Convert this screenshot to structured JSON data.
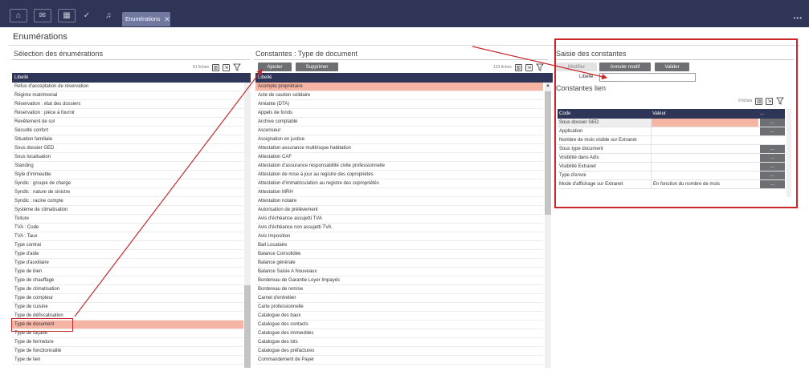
{
  "topbar": {
    "active_tab": "Enumérations",
    "close_glyph": "✕",
    "more_glyph": "•••",
    "icons": [
      "home-icon",
      "mail-icon",
      "calendar-icon",
      "check-icon",
      "bell-icon"
    ]
  },
  "page_title": "Enumérations",
  "left": {
    "title": "Sélection des énumérations",
    "count": "81 fiches",
    "column": "Libellé",
    "items": [
      "Refus d'acceptation de réservation",
      "Régime matrimonial",
      "Réservation : état des dossiers",
      "Réservation : pièce à fournir",
      "Revêtement de sol",
      "Sécurité confort",
      "Situation familiale",
      "Sous dossier GED",
      "Sous localisation",
      "Standing",
      "Style d'immeuble",
      "Syndic : groupe de charge",
      "Syndic : nature de sinistre",
      "Syndic : racine compte",
      "Système de climatisation",
      "Toiture",
      "TVA : Code",
      "TVA : Taux",
      "Type contrat",
      "Type d'aide",
      "Type d'auxiliaire",
      "Type de bien",
      "Type de chauffage",
      "Type de climatisation",
      "Type de compteur",
      "Type de cuisine",
      "Type de défiscalisation",
      "Type de document",
      "Type de façade",
      "Type de fermeture",
      "Type de fonctionnalité",
      "Type de lien"
    ],
    "selected_index": 27
  },
  "middle": {
    "title": "Constantes : Type de document",
    "add_label": "Ajouter",
    "delete_label": "Supprimer",
    "count": "133 fiches",
    "column": "Libellé",
    "items": [
      "Acompte propriétaire",
      "Acte de caution solidaire",
      "Amiante (DTA)",
      "Appels de fonds",
      "Archive comptable",
      "Ascenseur",
      "Assignation en justice",
      "Attestation assurance multirisque habitation",
      "Attestation CAF",
      "Attestation d'assurance responsabilité civile professionnelle",
      "Attestation de mise à jour au registre des copropriétés",
      "Attestation d'immatriculation au registre des copropriétés",
      "Attestation MRH",
      "Attestation notaire",
      "Autorisation de prélèvement",
      "Avis d'échéance assujetti TVA",
      "Avis d'échéance non assujetti TVA",
      "Avis Imposition",
      "Bail Locataire",
      "Balance Consolidée",
      "Balance générale",
      "Balance Saisie A Nouveaux",
      "Bordereau de Garantie Loyer Impayés",
      "Bordereau de remise",
      "Carnet d'entretien",
      "Carte professionnelle",
      "Catalogue des baux",
      "Catalogue des contacts",
      "Catalogue des immeubles",
      "Catalogue des lots",
      "Catalogue des préfactures",
      "Commandement de Payer"
    ],
    "selected_index": 0
  },
  "right": {
    "title": "Saisie des constantes",
    "modify_label": "Modifier",
    "cancel_label": "Annuler modif",
    "validate_label": "Valider",
    "field_label": "Libellé :",
    "field_value": "",
    "links_title": "Constantes lien",
    "count": "9 fiches",
    "col_code": "Code",
    "col_value": "Valeur",
    "col_action": "...",
    "rows": [
      {
        "code": "Sous dossier GED",
        "value": "",
        "button": "..."
      },
      {
        "code": "Application",
        "value": "",
        "button": "..."
      },
      {
        "code": "Nombre de mois visible sur Extranet",
        "value": "",
        "button": ""
      },
      {
        "code": "Sous type document",
        "value": "",
        "button": "..."
      },
      {
        "code": "Visibilité dans Adis",
        "value": "",
        "button": "..."
      },
      {
        "code": "Visibilité Extranet",
        "value": "",
        "button": "..."
      },
      {
        "code": "Type d'envoi",
        "value": "",
        "button": "..."
      },
      {
        "code": "Mode d'affichage sur Extranet",
        "value": "En fonction du nombre de mois",
        "button": "..."
      }
    ]
  },
  "colors": {
    "header": "#2e3556",
    "selection": "#f6b4a4",
    "annotation": "#c8282c"
  }
}
